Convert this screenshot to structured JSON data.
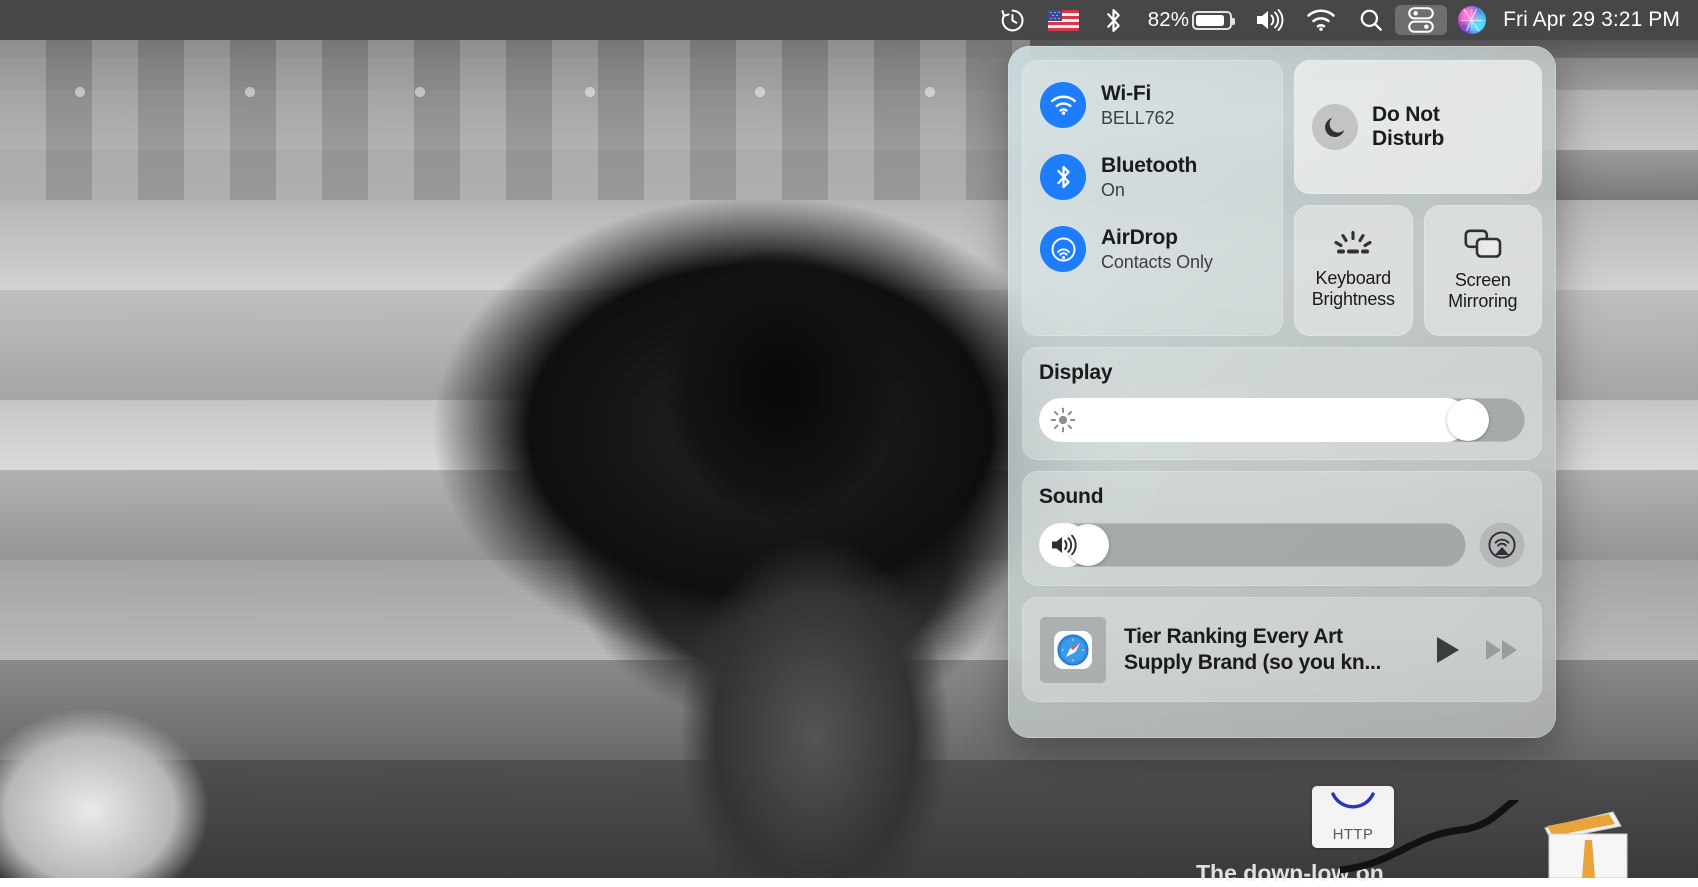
{
  "menubar": {
    "items": [
      {
        "name": "time-machine",
        "icon": "clock-history-icon",
        "label": ""
      },
      {
        "name": "input-language",
        "icon": "us-flag-icon",
        "label": ""
      },
      {
        "name": "bluetooth-menu",
        "icon": "bluetooth-icon",
        "label": ""
      },
      {
        "name": "battery",
        "icon": "battery-icon",
        "label": "82%"
      },
      {
        "name": "volume-menu",
        "icon": "speaker-icon",
        "label": ""
      },
      {
        "name": "wifi-menu",
        "icon": "wifi-icon",
        "label": ""
      },
      {
        "name": "spotlight",
        "icon": "search-icon",
        "label": ""
      },
      {
        "name": "control-center",
        "icon": "control-center-icon",
        "label": ""
      },
      {
        "name": "siri",
        "icon": "siri-orb-icon",
        "label": ""
      }
    ],
    "battery_percent": "82%",
    "battery_level": 86,
    "clock": "Fri Apr 29  3:21 PM",
    "date_text": "Fri Apr 29",
    "time_text": "3:21 PM",
    "active_item": "control-center"
  },
  "control_center": {
    "connectivity": {
      "toggles": [
        {
          "icon": "wifi-icon",
          "title": "Wi-Fi",
          "status": "BELL762",
          "active": true
        },
        {
          "icon": "bluetooth-icon",
          "title": "Bluetooth",
          "status": "On",
          "active": true
        },
        {
          "icon": "airdrop-icon",
          "title": "AirDrop",
          "status": "Contacts Only",
          "active": true
        }
      ],
      "active_color": "#1d7dfb"
    },
    "do_not_disturb": {
      "label": "Do Not Disturb",
      "line1": "Do Not",
      "line2": "Disturb",
      "icon": "moon-icon",
      "enabled": false
    },
    "quick_tiles": [
      {
        "icon": "keyboard-brightness-icon",
        "line1": "Keyboard",
        "line2": "Brightness",
        "label": "Keyboard Brightness"
      },
      {
        "icon": "screen-mirroring-icon",
        "line1": "Screen",
        "line2": "Mirroring",
        "label": "Screen Mirroring"
      }
    ],
    "display": {
      "title": "Display",
      "icon": "brightness-sun-icon",
      "value": 92
    },
    "sound": {
      "title": "Sound",
      "icon": "speaker-icon",
      "value": 7,
      "airplay_icon": "airplay-audio-icon"
    },
    "now_playing": {
      "title": "Tier Ranking Every Art Supply Brand (so you kn...",
      "app_icon": "safari-icon",
      "play_icon": "play-icon",
      "forward_icon": "fast-forward-icon"
    }
  },
  "desktop": {
    "http_icon_label": "HTTP",
    "bottom_text": "The down-low on"
  }
}
